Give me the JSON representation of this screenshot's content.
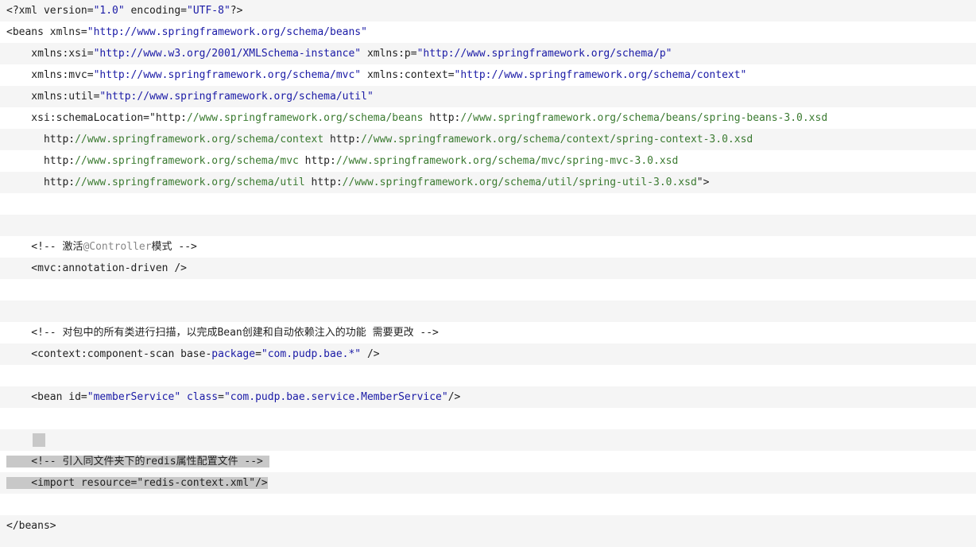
{
  "colors": {
    "alt_bg": "#f5f5f5",
    "plain_bg": "#ffffff",
    "text": "#222222",
    "string": "#1a1aa6",
    "url_path": "#3a7a30",
    "annotation": "#888888",
    "selection": "#c8c8c8"
  },
  "lines": [
    {
      "bg": "alt",
      "tokens": [
        {
          "t": "<?xml version="
        },
        {
          "t": "\"1.0\"",
          "c": "s"
        },
        {
          "t": " encoding="
        },
        {
          "t": "\"UTF-8\"",
          "c": "s"
        },
        {
          "t": "?>"
        }
      ]
    },
    {
      "bg": "plain",
      "tokens": [
        {
          "t": "<beans xmlns="
        },
        {
          "t": "\"http://www.springframework.org/schema/beans\"",
          "c": "s"
        }
      ]
    },
    {
      "bg": "alt",
      "tokens": [
        {
          "t": "    xmlns:xsi="
        },
        {
          "t": "\"http://www.w3.org/2001/XMLSchema-instance\"",
          "c": "s"
        },
        {
          "t": " xmlns:p="
        },
        {
          "t": "\"http://www.springframework.org/schema/p\"",
          "c": "s"
        }
      ]
    },
    {
      "bg": "plain",
      "tokens": [
        {
          "t": "    xmlns:mvc="
        },
        {
          "t": "\"http://www.springframework.org/schema/mvc\"",
          "c": "s"
        },
        {
          "t": " xmlns:context="
        },
        {
          "t": "\"http://www.springframework.org/schema/context\"",
          "c": "s"
        }
      ]
    },
    {
      "bg": "alt",
      "tokens": [
        {
          "t": "    xmlns:util="
        },
        {
          "t": "\"http://www.springframework.org/schema/util\"",
          "c": "s"
        }
      ]
    },
    {
      "bg": "plain",
      "tokens": [
        {
          "t": "    xsi:schemaLocation=\"http:"
        },
        {
          "t": "//www.springframework.org/schema/beans",
          "c": "u"
        },
        {
          "t": " http:"
        },
        {
          "t": "//www.springframework.org/schema/beans/spring-beans-3.0.xsd",
          "c": "u"
        }
      ]
    },
    {
      "bg": "alt",
      "tokens": [
        {
          "t": "      http:"
        },
        {
          "t": "//www.springframework.org/schema/context",
          "c": "u"
        },
        {
          "t": " http:"
        },
        {
          "t": "//www.springframework.org/schema/context/spring-context-3.0.xsd",
          "c": "u"
        }
      ]
    },
    {
      "bg": "plain",
      "tokens": [
        {
          "t": "      http:"
        },
        {
          "t": "//www.springframework.org/schema/mvc",
          "c": "u"
        },
        {
          "t": " http:"
        },
        {
          "t": "//www.springframework.org/schema/mvc/spring-mvc-3.0.xsd",
          "c": "u"
        }
      ]
    },
    {
      "bg": "alt",
      "tokens": [
        {
          "t": "      http:"
        },
        {
          "t": "//www.springframework.org/schema/util",
          "c": "u"
        },
        {
          "t": " http:"
        },
        {
          "t": "//www.springframework.org/schema/util/spring-util-3.0.xsd",
          "c": "u"
        },
        {
          "t": "\">"
        }
      ]
    },
    {
      "bg": "plain",
      "tokens": []
    },
    {
      "bg": "alt",
      "tokens": []
    },
    {
      "bg": "plain",
      "tokens": [
        {
          "t": "    <!-- 激活"
        },
        {
          "t": "@Controller",
          "c": "c"
        },
        {
          "t": "模式 -->"
        }
      ]
    },
    {
      "bg": "alt",
      "tokens": [
        {
          "t": "    <mvc:annotation-driven />"
        }
      ]
    },
    {
      "bg": "plain",
      "tokens": []
    },
    {
      "bg": "alt",
      "tokens": []
    },
    {
      "bg": "plain",
      "tokens": [
        {
          "t": "    <!-- 对包中的所有类进行扫描，以完成Bean创建和自动依赖注入的功能 需要更改 -->"
        }
      ]
    },
    {
      "bg": "alt",
      "tokens": [
        {
          "t": "    <context:component-scan base-"
        },
        {
          "t": "package",
          "c": "s"
        },
        {
          "t": "="
        },
        {
          "t": "\"com.pudp.bae.*\"",
          "c": "s"
        },
        {
          "t": " />"
        }
      ]
    },
    {
      "bg": "plain",
      "tokens": []
    },
    {
      "bg": "alt",
      "tokens": [
        {
          "t": "    <bean id="
        },
        {
          "t": "\"memberService\"",
          "c": "s"
        },
        {
          "t": " "
        },
        {
          "t": "class",
          "c": "s"
        },
        {
          "t": "="
        },
        {
          "t": "\"com.pudp.bae.service.MemberService\"",
          "c": "s"
        },
        {
          "t": "/>"
        }
      ]
    },
    {
      "bg": "plain",
      "tokens": []
    },
    {
      "bg": "alt",
      "tokens": [],
      "selblock": true
    },
    {
      "bg": "plain",
      "sel": true,
      "tokens": [
        {
          "t": "    <!-- 引入同文件夹下的redis属性配置文件 --> "
        }
      ]
    },
    {
      "bg": "alt",
      "sel": true,
      "tokens": [
        {
          "t": "    <import resource=\"redis-context.xml\"/>"
        }
      ]
    },
    {
      "bg": "plain",
      "tokens": []
    },
    {
      "bg": "alt",
      "tokens": [
        {
          "t": "</beans>"
        }
      ]
    }
  ]
}
